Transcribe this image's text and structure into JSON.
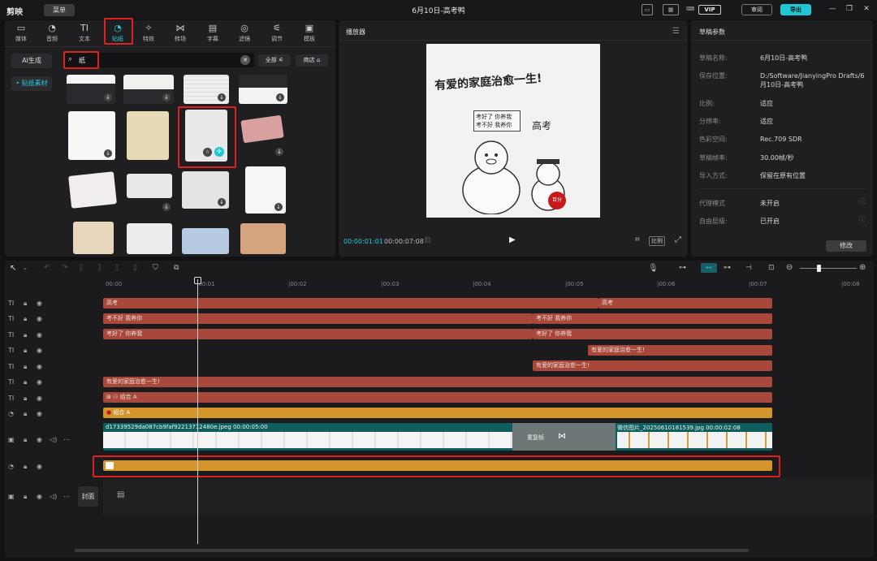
{
  "app": {
    "logo": "剪映",
    "menu": "菜单",
    "title": "6月10日-高考鸭",
    "vip": "VIP",
    "review": "审阅",
    "export": "导出"
  },
  "tabs": [
    {
      "label": "媒体",
      "icon": "▭"
    },
    {
      "label": "音频",
      "icon": "◔"
    },
    {
      "label": "文本",
      "icon": "TI"
    },
    {
      "label": "贴纸",
      "icon": "◔"
    },
    {
      "label": "特效",
      "icon": "✧"
    },
    {
      "label": "转场",
      "icon": "⋈"
    },
    {
      "label": "字幕",
      "icon": "▤"
    },
    {
      "label": "滤镜",
      "icon": "◎"
    },
    {
      "label": "调节",
      "icon": "⚟"
    },
    {
      "label": "模板",
      "icon": "▣"
    }
  ],
  "active_tab": "贴纸",
  "sidebar": {
    "ai": "AI生成",
    "material": "• 贴纸素材"
  },
  "search": {
    "value": "纸",
    "all": "全部",
    "store": "商店"
  },
  "player": {
    "title": "播放器",
    "time_current": "00:00:01:01",
    "time_total": "00:00:07:08",
    "ratio": "比例",
    "canvas_title": "有爱的家庭治愈一生!",
    "canvas_sign": "考好了 你养我 考不好 我养你",
    "canvas_kaokao": "高考",
    "seal": "百分"
  },
  "props": {
    "title": "草稿参数",
    "rows": [
      {
        "label": "草稿名称:",
        "value": "6月10日-高考鸭"
      },
      {
        "label": "保存位置:",
        "value": "D:/Software/JianyingPro Drafts/6月10日-高考鸭"
      },
      {
        "label": "比例:",
        "value": "适应"
      },
      {
        "label": "分辨率:",
        "value": "适应"
      },
      {
        "label": "色彩空间:",
        "value": "Rec.709 SDR"
      },
      {
        "label": "草稿帧率:",
        "value": "30.00帧/秒"
      },
      {
        "label": "导入方式:",
        "value": "保留在原有位置"
      },
      {
        "label": "代理模式",
        "value": "未开启"
      },
      {
        "label": "自由层级:",
        "value": "已开启"
      }
    ],
    "modify": "修改"
  },
  "ruler": [
    "00:00",
    "|00:01",
    "|00:02",
    "|00:03",
    "|00:04",
    "|00:05",
    "|00:06",
    "|00:07",
    "|00:08"
  ],
  "tracks": {
    "t1": [
      "高考",
      "高考"
    ],
    "t2": [
      "考不好 我养你",
      "考不好 我养你"
    ],
    "t3": [
      "考好了 你养我",
      "考好了 你养我"
    ],
    "t4": "有爱的家庭治愈一生!",
    "t5": "有爱的家庭治愈一生!",
    "t6": "有爱的家庭治愈一生!",
    "t7": "组合 A",
    "t8": "组合 A",
    "video1": "d17339529da087cb9faf92213712480e.jpeg  00:00:05:00",
    "video2": "微信图片_20250610181539.jpg  00:00:02:08",
    "transition": "重复帧",
    "cover": "封面"
  },
  "colors": {
    "accent": "#25c9d8",
    "text_clip": "#a8483a",
    "sticker_clip": "#d4962a",
    "highlight": "#e02020"
  }
}
